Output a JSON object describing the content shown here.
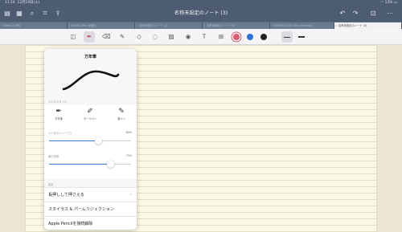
{
  "status_bar": {
    "time": "11:14",
    "date": "12月19日(火)",
    "battery": "13%"
  },
  "toolbar": {
    "document_title": "名称未設定のノート (3)"
  },
  "tabs": [
    {
      "label": "Web 01 資料"
    },
    {
      "label": "NAO02-iPad-全般比"
    },
    {
      "label": "名称未設定のノート (2)"
    },
    {
      "label": "名称未設定のノート (3)"
    },
    {
      "label": "KNOTES_020-GSE_notebook_)"
    },
    {
      "label": "名称未設定のノート (3)"
    }
  ],
  "pen_popup": {
    "title": "万年筆",
    "section_pen_style": "ペンのスタイル",
    "pens": [
      {
        "label": "万年筆"
      },
      {
        "label": "ボールペン"
      },
      {
        "label": "筆ペン"
      }
    ],
    "sharpness": {
      "label": "ペン先のシャープさ",
      "value_text": "60%",
      "value": 0.6
    },
    "pressure": {
      "label": "筆圧感度",
      "value_text": "75%",
      "value": 0.75
    },
    "settings_header": "設定",
    "menu": [
      {
        "label": "長押しして押さえる",
        "chevron": "›"
      },
      {
        "label": "スタイラス & パームリジェクション",
        "chevron": ""
      },
      {
        "label": "Apple Pencilを接続解除",
        "chevron": ""
      }
    ]
  },
  "colors": {
    "accent": "#3b7bd4",
    "pink": "#e05a6e",
    "blue": "#2f6fcf",
    "toolbar_bg": "#4d5c71"
  },
  "icons": [
    "sidebar-icon",
    "grid-icon",
    "bookmark-icon",
    "share-icon",
    "undo-icon",
    "redo-icon",
    "add-page-icon",
    "more-icon",
    "fountain-pen-icon",
    "eraser-icon",
    "highlighter-icon",
    "shapes-icon",
    "lasso-icon",
    "image-icon",
    "camera-icon",
    "textbox-icon",
    "zoom-icon",
    "laser-pointer-icon"
  ]
}
